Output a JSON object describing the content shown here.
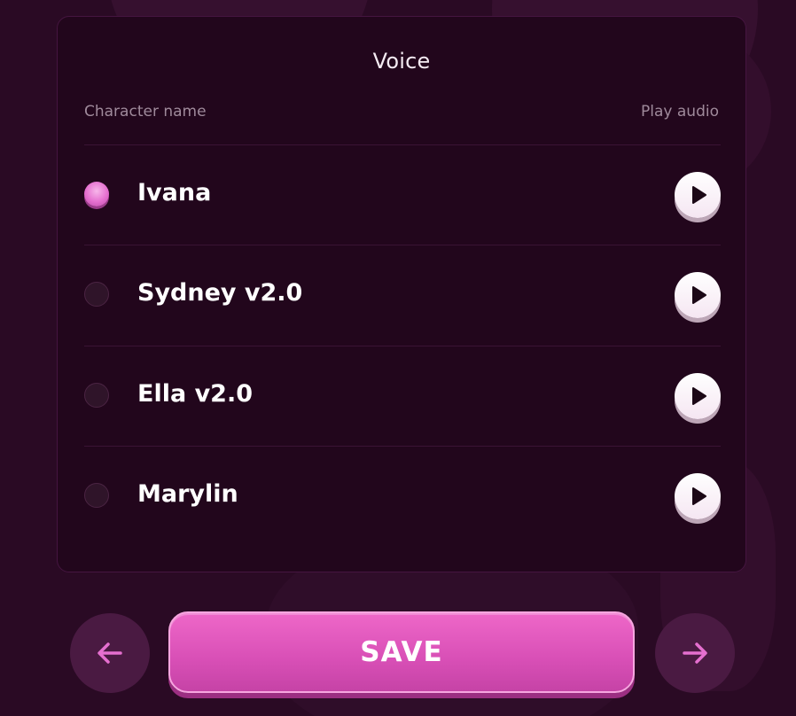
{
  "panel": {
    "title": "Voice",
    "column_left": "Character name",
    "column_right": "Play audio"
  },
  "voices": [
    {
      "name": "Ivana",
      "selected": true
    },
    {
      "name": "Sydney v2.0",
      "selected": false
    },
    {
      "name": "Ella v2.0",
      "selected": false
    },
    {
      "name": "Marylin",
      "selected": false
    }
  ],
  "footer": {
    "save_label": "SAVE",
    "prev_icon": "arrow-left-icon",
    "next_icon": "arrow-right-icon"
  },
  "colors": {
    "background": "#2a0a24",
    "panel": "#22061c",
    "accent": "#e056c0",
    "nav_button": "#4a1a42",
    "arrow": "#e56fcf"
  }
}
